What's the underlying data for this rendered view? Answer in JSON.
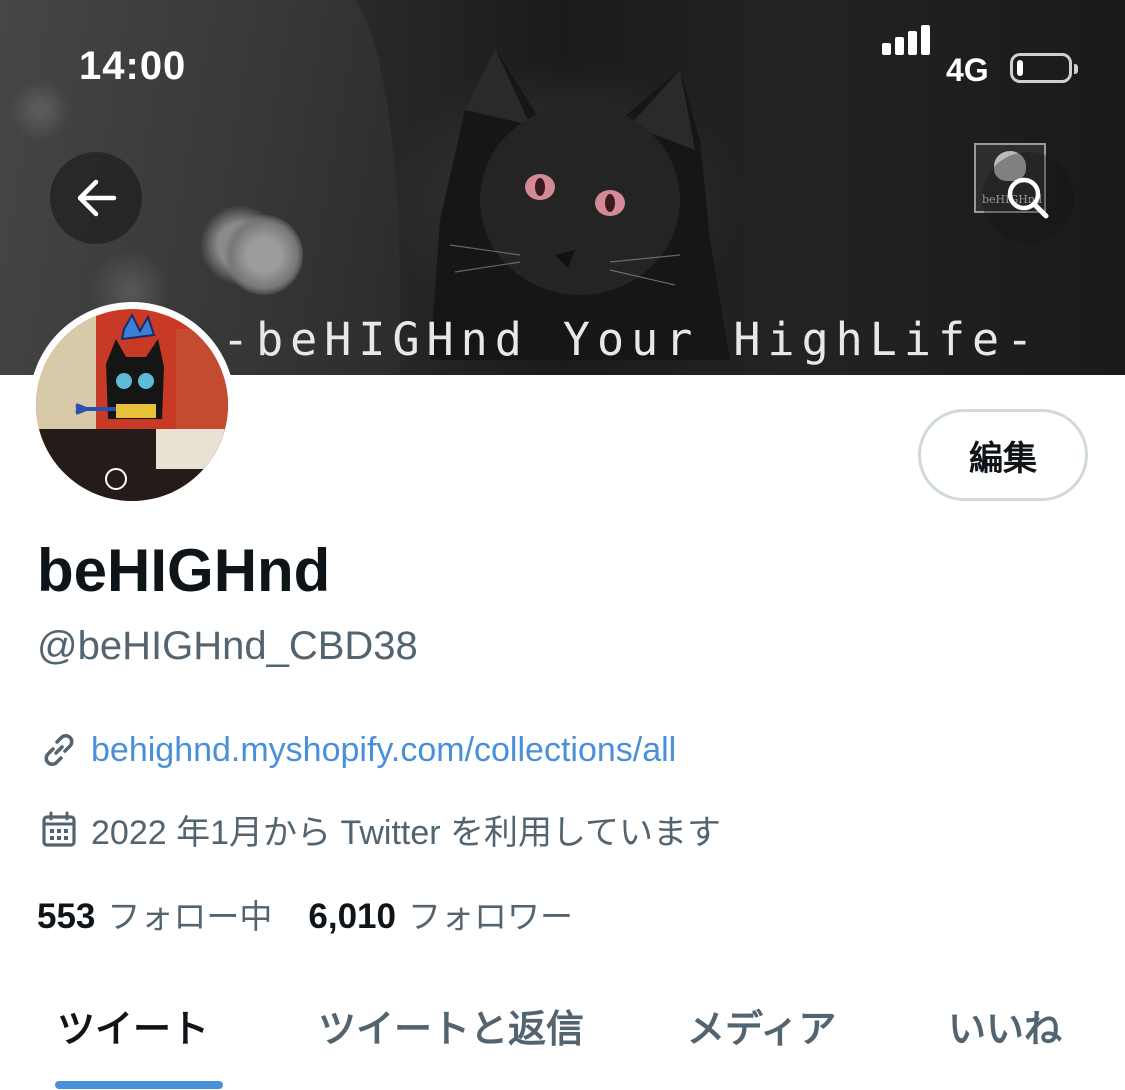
{
  "status_bar": {
    "time": "14:00",
    "network": "4G",
    "battery_level": 0.12
  },
  "banner": {
    "caption": "-beHIGHnd Your HighLife-"
  },
  "header": {
    "back_icon": "arrow-left-icon",
    "search_icon": "search-icon"
  },
  "profile": {
    "display_name": "beHIGHnd",
    "handle": "@beHIGHnd_CBD38",
    "edit_label": "編集",
    "website": "behighnd.myshopify.com/collections/all",
    "joined": "2022 年1月から Twitter を利用しています",
    "following_count": "553",
    "following_label": "フォロー中",
    "followers_count": "6,010",
    "followers_label": "フォロワー"
  },
  "tabs": [
    {
      "label": "ツイート",
      "active": true
    },
    {
      "label": "ツイートと返信",
      "active": false
    },
    {
      "label": "メディア",
      "active": false
    },
    {
      "label": "いいね",
      "active": false
    }
  ],
  "colors": {
    "accent": "#4a90d9",
    "text_primary": "#0f1419",
    "text_secondary": "#536471",
    "border": "#cfd9de"
  }
}
